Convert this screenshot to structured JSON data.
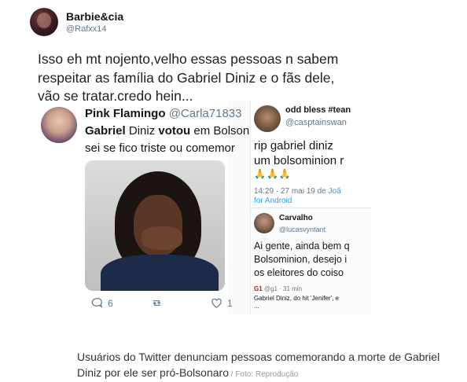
{
  "tweet": {
    "display_name": "Barbie&cia",
    "handle": "@Rafxx14",
    "text": "Isso eh mt nojento,velho essas pessoas n sabem respeitar as família do Gabriel Diniz e o fãs dele, vão se tratar,credo hein..."
  },
  "left_screenshot": {
    "name": "Pink Flamingo",
    "handle": "@Carla71833",
    "line1_bold1": "Gabriel",
    "line1_mid": " Diniz ",
    "line1_bold2": "votou",
    "line1_end": " em Bolsona",
    "line2": "sei se fico triste ou comemor",
    "reply_count": "6",
    "like_count": "1"
  },
  "right_screenshot": {
    "name": "odd bless #tean",
    "handle": "@casptainswan",
    "text_line1": "rip gabriel diniz",
    "text_line2": "um bolsominion r",
    "emoji": "🙏🙏🙏",
    "time": "14:29 · 27 mai 19 de ",
    "time_link": "Joã",
    "platform": "for Android",
    "quote": {
      "name": "Carvalho",
      "handle": "@lucasvyntant",
      "line1": "Ai gente, ainda bem q",
      "line2": "Bolsominion, desejo i",
      "line3": "os eleitores do coiso",
      "g1_label": "G1",
      "g1_meta": " @g1 · 31 min",
      "g1_line1": "Gabriel Diniz, do hit 'Jenifer', e",
      "g1_line2": "..."
    }
  },
  "caption": {
    "text": "Usuários do Twitter denunciam pessoas comemorando a morte de Gabriel Diniz por ele ser pró-Bolsonaro",
    "credit": " / Foto: Reprodução"
  }
}
